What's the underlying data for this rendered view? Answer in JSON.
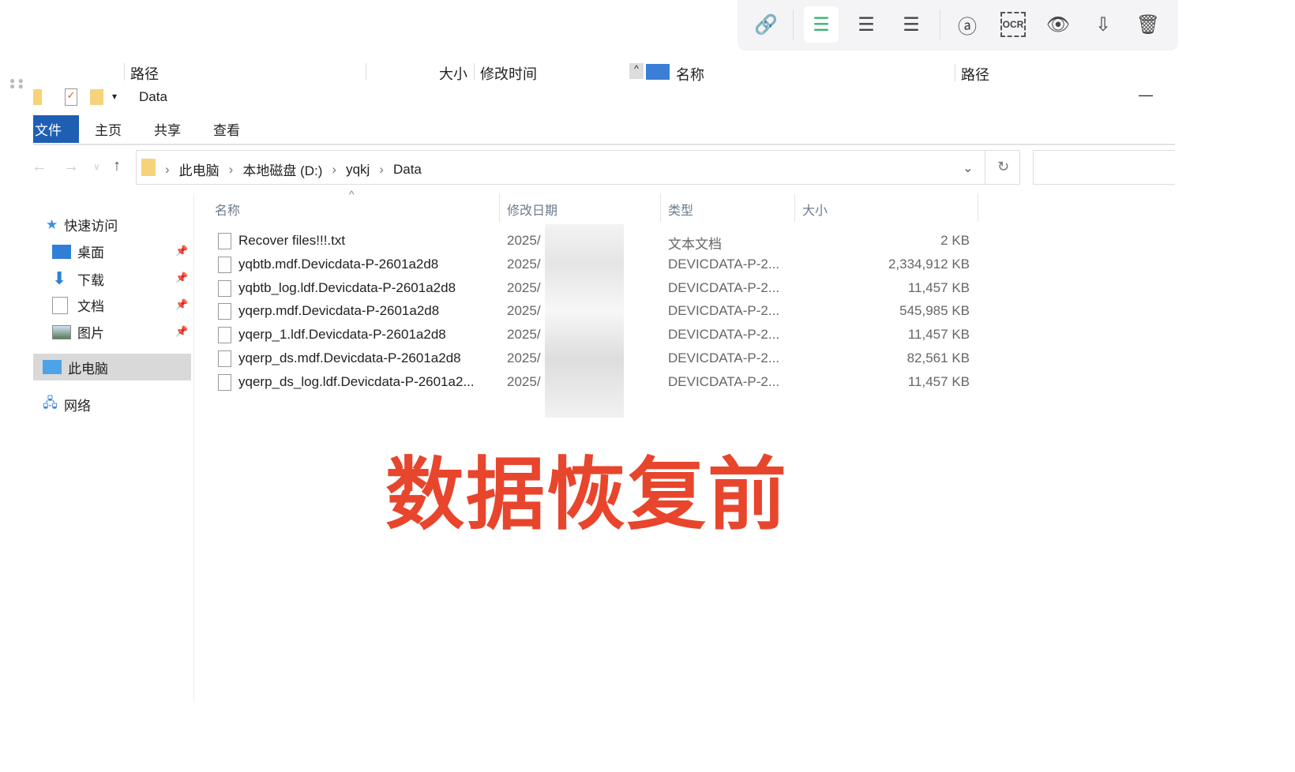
{
  "top_toolbar": {
    "icons": [
      "link-icon",
      "align-left-icon",
      "align-center-icon",
      "align-right-icon",
      "at-icon",
      "ocr-icon",
      "eye-icon",
      "download-icon",
      "trash-icon"
    ],
    "ocr_label": "OCR",
    "active_color": "#3cb371"
  },
  "overlay_headers": {
    "path1": "路径",
    "size": "大小",
    "modified": "修改时间",
    "name": "名称",
    "path2": "路径"
  },
  "window": {
    "title": "Data",
    "minimize": "—"
  },
  "ribbon": {
    "file": "文件",
    "home": "主页",
    "share": "共享",
    "view": "查看",
    "file_color": "#1e5fb4"
  },
  "address": {
    "crumbs": [
      "此电脑",
      "本地磁盘 (D:)",
      "yqkj",
      "Data"
    ]
  },
  "sidebar": {
    "quick_access": "快速访问",
    "items": [
      "桌面",
      "下载",
      "文档",
      "图片"
    ],
    "this_pc": "此电脑",
    "network": "网络"
  },
  "columns": {
    "name": "名称",
    "date": "修改日期",
    "type": "类型",
    "size": "大小"
  },
  "files": [
    {
      "name": "Recover files!!!.txt",
      "date": "2025/",
      "type": "文本文档",
      "size": "2 KB"
    },
    {
      "name": "yqbtb.mdf.Devicdata-P-2601a2d8",
      "date": "2025/",
      "type": "DEVICDATA-P-2...",
      "size": "2,334,912 KB"
    },
    {
      "name": "yqbtb_log.ldf.Devicdata-P-2601a2d8",
      "date": "2025/",
      "type": "DEVICDATA-P-2...",
      "size": "11,457 KB"
    },
    {
      "name": "yqerp.mdf.Devicdata-P-2601a2d8",
      "date": "2025/",
      "type": "DEVICDATA-P-2...",
      "size": "545,985 KB"
    },
    {
      "name": "yqerp_1.ldf.Devicdata-P-2601a2d8",
      "date": "2025/",
      "type": "DEVICDATA-P-2...",
      "size": "11,457 KB"
    },
    {
      "name": "yqerp_ds.mdf.Devicdata-P-2601a2d8",
      "date": "2025/",
      "type": "DEVICDATA-P-2...",
      "size": "82,561 KB"
    },
    {
      "name": "yqerp_ds_log.ldf.Devicdata-P-2601a2...",
      "date": "2025/",
      "type": "DEVICDATA-P-2...",
      "size": "11,457 KB"
    }
  ],
  "caption": "数据恢复前"
}
